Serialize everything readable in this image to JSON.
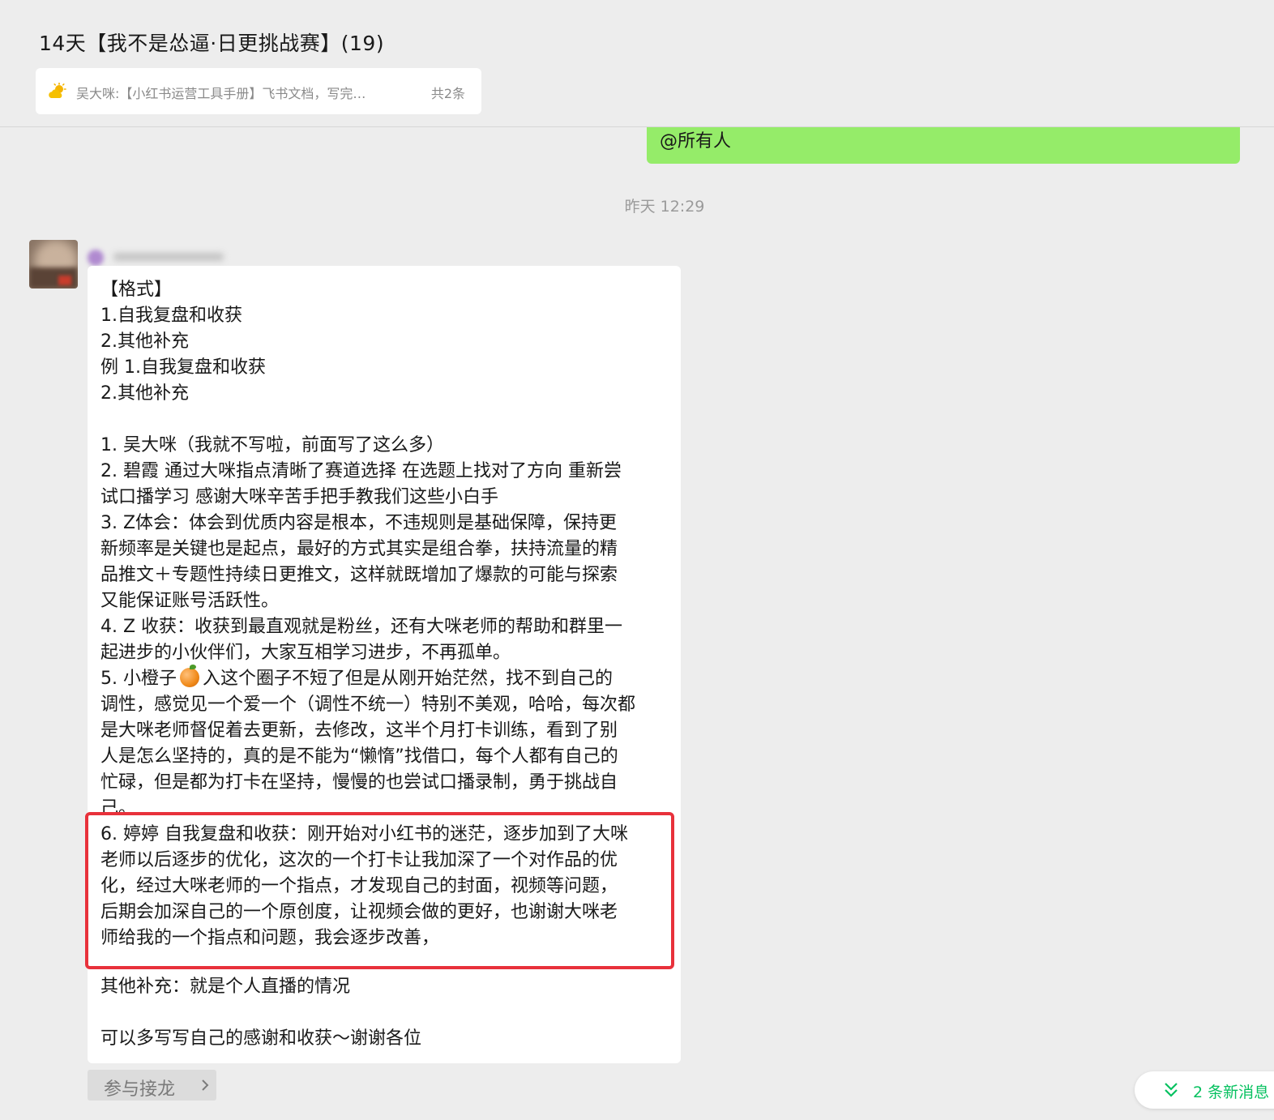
{
  "chat": {
    "title": "14天【我不是怂逼·日更挑战赛】(19)",
    "pinned": {
      "icon": "sun-cloud-icon",
      "text": "吴大咪:【小红书运营工具手册】飞书文档，写完…",
      "count": "共2条"
    }
  },
  "messages": {
    "mention": "@所有人",
    "timestamp": "昨天 12:29",
    "main_lines": [
      "【格式】",
      "1.自我复盘和收获",
      "2.其他补充",
      "例 1.自我复盘和收获",
      "2.其他补充",
      "1. 吴大咪（我就不写啦，前面写了这么多）",
      "2. 碧霞 通过大咪指点清晰了赛道选择 在选题上找对了方向 重新尝",
      "试口播学习 感谢大咪辛苦手把手教我们这些小白手",
      "3. Z体会：体会到优质内容是根本，不违规则是基础保障，保持更",
      "新频率是关键也是起点，最好的方式其实是组合拳，扶持流量的精",
      "品推文＋专题性持续日更推文，这样就既增加了爆款的可能与探索",
      "又能保证账号活跃性。",
      "4. Z 收获：收获到最直观就是粉丝，还有大咪老师的帮助和群里一",
      "起进步的小伙伴们，大家互相学习进步，不再孤单。",
      "5. 小橙子",
      "入这个圈子不短了但是从刚开始茫然，找不到自己的",
      "调性，感觉见一个爱一个（调性不统一）特别不美观，哈哈，每次都",
      "是大咪老师督促着去更新，去修改，这半个月打卡训练，看到了别",
      "人是怎么坚持的，真的是不能为“懒惰”找借口，每个人都有自己的",
      "忙碌，但是都为打卡在坚持，慢慢的也尝试口播录制，勇于挑战自",
      "己。",
      "6. 婷婷 自我复盘和收获：刚开始对小红书的迷茫，逐步加到了大咪",
      "老师以后逐步的优化，这次的一个打卡让我加深了一个对作品的优",
      "化，经过大咪老师的一个指点，才发现自己的封面，视频等问题，",
      "后期会加深自己的一个原创度，让视频会做的更好，也谢谢大咪老",
      "师给我的一个指点和问题，我会逐步改善，",
      "其他补充：就是个人直播的情况",
      "可以多写写自己的感谢和收获～谢谢各位"
    ],
    "join_button": "参与接龙",
    "new_messages": "2 条新消息"
  },
  "colors": {
    "background": "#ededed",
    "bubble_self": "#95ec69",
    "bubble_other": "#ffffff",
    "highlight_border": "#e8313b",
    "new_msg_green": "#07c160"
  }
}
